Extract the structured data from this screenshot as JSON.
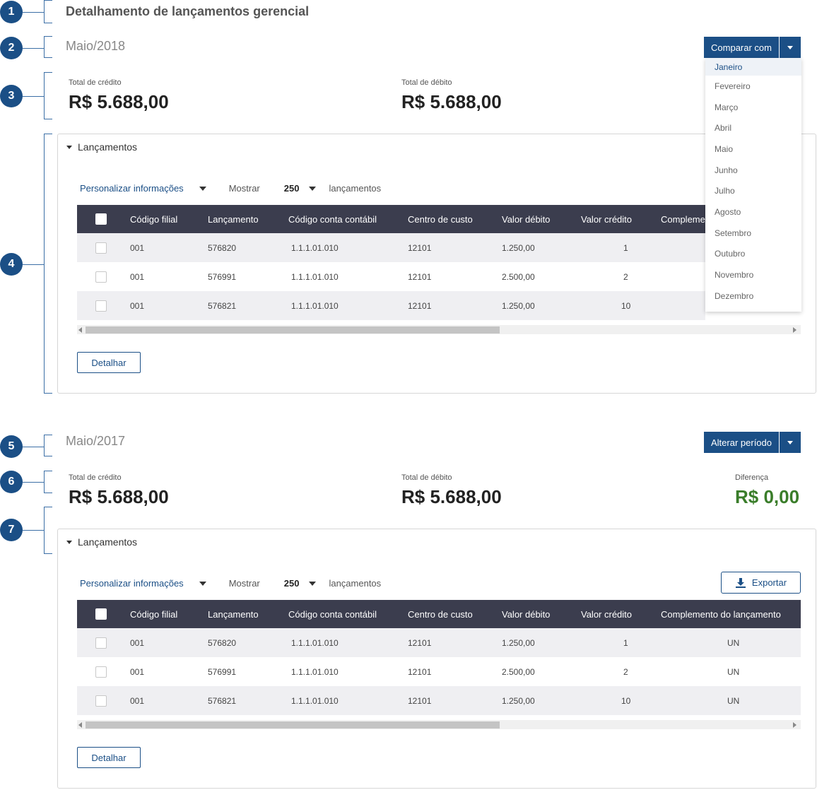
{
  "page_title": "Detalhamento de lançamentos gerencial",
  "markers": [
    "1",
    "2",
    "3",
    "4",
    "5",
    "6",
    "7"
  ],
  "section_a": {
    "period": "Maio/2018",
    "action_button": "Comparar com",
    "credit_label": "Total de crédito",
    "credit_value": "R$ 5.688,00",
    "debit_label": "Total de débito",
    "debit_value": "R$ 5.688,00",
    "panel_title": "Lançamentos",
    "customize": "Personalizar informações",
    "show_label": "Mostrar",
    "show_count": "250",
    "show_suffix": "lançamentos",
    "detail_button": "Detalhar"
  },
  "section_b": {
    "period": "Maio/2017",
    "action_button": "Alterar período",
    "credit_label": "Total de crédito",
    "credit_value": "R$ 5.688,00",
    "debit_label": "Total de débito",
    "debit_value": "R$ 5.688,00",
    "diff_label": "Diferença",
    "diff_value": "R$ 0,00",
    "panel_title": "Lançamentos",
    "customize": "Personalizar informações",
    "show_label": "Mostrar",
    "show_count": "250",
    "show_suffix": "lançamentos",
    "export_button": "Exportar",
    "detail_button": "Detalhar"
  },
  "table": {
    "columns": [
      "Código filial",
      "Lançamento",
      "Código conta contábil",
      "Centro de custo",
      "Valor débito",
      "Valor crédito",
      "Complemento do lançamento"
    ],
    "columns_truncated_a": "Compleme",
    "rows": [
      [
        "001",
        "576820",
        "1.1.1.01.010",
        "12101",
        "1.250,00",
        "1",
        "UN"
      ],
      [
        "001",
        "576991",
        "1.1.1.01.010",
        "12101",
        "2.500,00",
        "2",
        "UN"
      ],
      [
        "001",
        "576821",
        "1.1.1.01.010",
        "12101",
        "1.250,00",
        "10",
        "UN"
      ]
    ]
  },
  "months": [
    "Janeiro",
    "Fevereiro",
    "Março",
    "Abril",
    "Maio",
    "Junho",
    "Julho",
    "Agosto",
    "Setembro",
    "Outubro",
    "Novembro",
    "Dezembro"
  ],
  "colors": {
    "primary": "#1b4f86",
    "header": "#3b3d4e",
    "positive": "#3a7d2a"
  }
}
